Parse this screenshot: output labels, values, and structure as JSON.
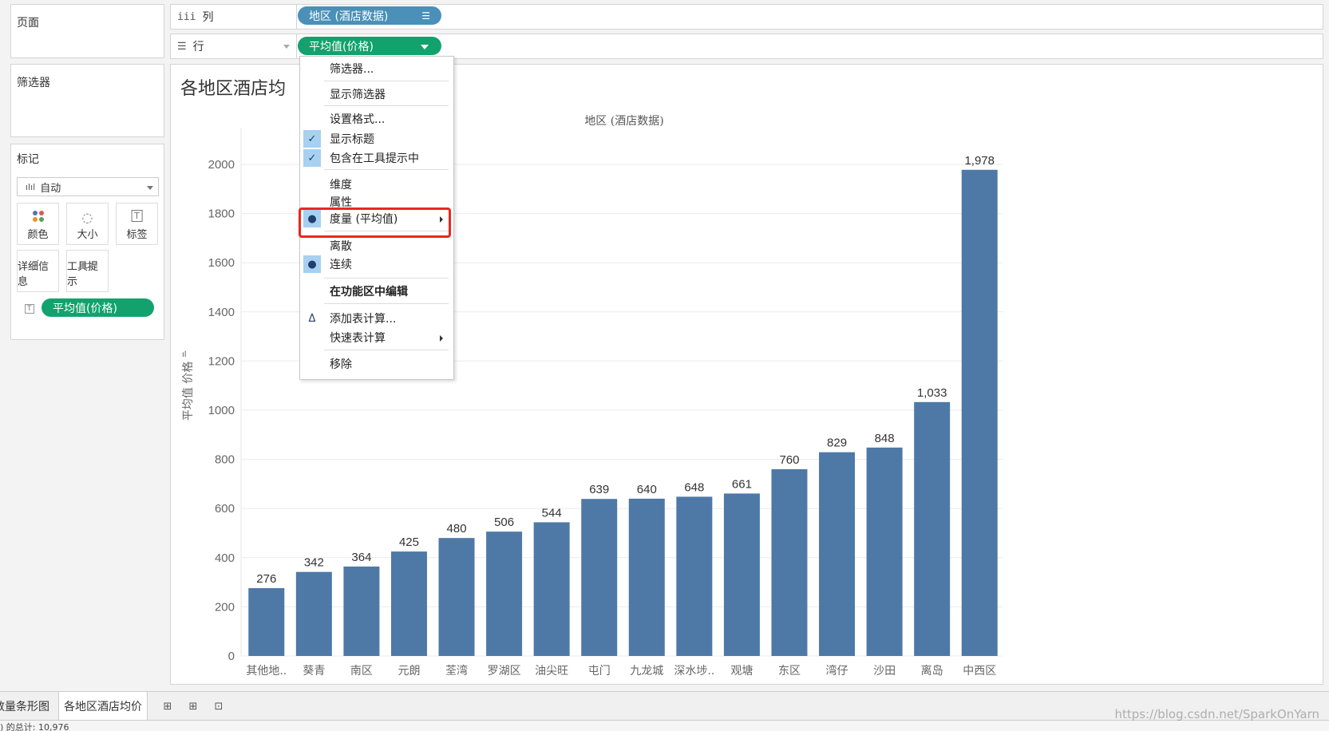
{
  "panels": {
    "pages_title": "页面",
    "filters_title": "筛选器",
    "marks_title": "标记",
    "marks_type": "自动",
    "mark_buttons": [
      "颜色",
      "大小",
      "标签",
      "详细信息",
      "工具提示"
    ],
    "mark_pill": "平均值(价格)"
  },
  "shelves": {
    "columns_label": "列",
    "columns_icon": "iii",
    "rows_label": "行",
    "rows_icon": "☰",
    "columns_pill": "地区 (酒店数据)",
    "rows_pill": "平均值(价格)"
  },
  "view": {
    "title": "各地区酒店均",
    "header": "地区 (酒店数据)",
    "ylabel": "平均值 价格"
  },
  "context_menu": {
    "items": [
      {
        "label": "筛选器..."
      },
      {
        "label": "显示筛选器"
      },
      {
        "label": "设置格式..."
      },
      {
        "label": "显示标题",
        "check": "✓"
      },
      {
        "label": "包含在工具提示中",
        "check": "✓"
      },
      {
        "label": "维度"
      },
      {
        "label": "属性"
      },
      {
        "label": "度量 (平均值)",
        "check": "●"
      },
      {
        "label": "离散"
      },
      {
        "label": "连续",
        "check": "●"
      },
      {
        "label": "在功能区中编辑"
      },
      {
        "label": "添加表计算..."
      },
      {
        "label": "快速表计算"
      },
      {
        "label": "移除"
      }
    ],
    "delta_icon": "Δ"
  },
  "tabs": {
    "left_partial": "数量条形图",
    "active": "各地区酒店均价"
  },
  "status": {
    "text": ") 的总计: 10,976"
  },
  "watermark": "https://blog.csdn.net/SparkOnYarn",
  "colors": {
    "bar": "#4e79a7",
    "highlight": "#e8281f",
    "pill_blue": "#4a90b8",
    "pill_green": "#13a26d"
  },
  "chart_data": {
    "type": "bar",
    "categories": [
      "其他地..",
      "葵青",
      "南区",
      "元朗",
      "荃湾",
      "罗湖区",
      "油尖旺",
      "屯门",
      "九龙城",
      "深水埗..",
      "观塘",
      "东区",
      "湾仔",
      "沙田",
      "离岛",
      "中西区"
    ],
    "values": [
      276,
      342,
      364,
      425,
      480,
      506,
      544,
      639,
      640,
      648,
      661,
      760,
      829,
      848,
      1033,
      1978
    ],
    "labels": [
      "276",
      "342",
      "364",
      "425",
      "480",
      "506",
      "544",
      "639",
      "640",
      "648",
      "661",
      "760",
      "829",
      "848",
      "1,033",
      "1,978"
    ],
    "yticks": [
      0,
      200,
      400,
      600,
      800,
      1000,
      1200,
      1400,
      1600,
      1800,
      2000
    ],
    "ylim": [
      0,
      2000
    ],
    "xlabel": "地区 (酒店数据)",
    "ylabel": "平均值 价格",
    "grid": true
  }
}
